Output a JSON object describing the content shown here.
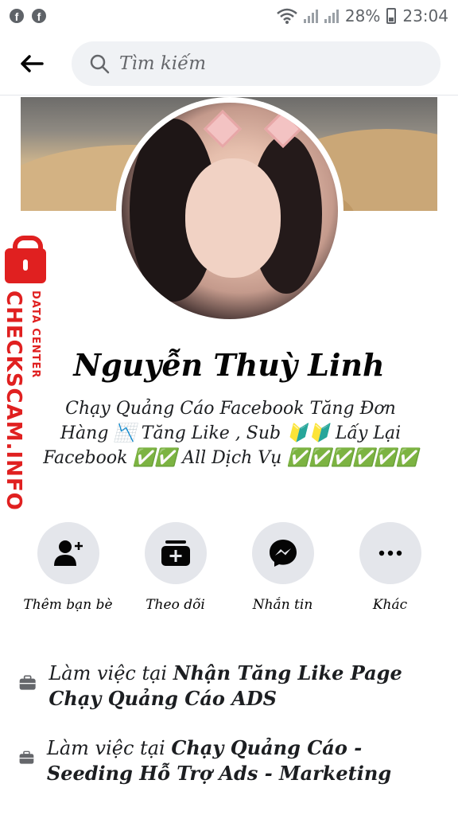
{
  "status_bar": {
    "battery": "28%",
    "time": "23:04"
  },
  "header": {
    "search_placeholder": "Tìm kiếm"
  },
  "watermark": {
    "main": "CHECKSCAM.INFO",
    "sub": "DATA CENTER"
  },
  "profile": {
    "name": "Nguyễn Thuỳ Linh",
    "bio": "Chạy Quảng Cáo Facebook Tăng Đơn Hàng 📉 Tăng Like , Sub 🔰🔰 Lấy Lại Facebook ✅✅ All Dịch Vụ ✅✅✅✅✅✅"
  },
  "actions": [
    {
      "label": "Thêm bạn bè",
      "icon": "add-friend-icon"
    },
    {
      "label": "Theo dõi",
      "icon": "follow-icon"
    },
    {
      "label": "Nhắn tin",
      "icon": "messenger-icon"
    },
    {
      "label": "Khác",
      "icon": "more-icon"
    }
  ],
  "work": [
    {
      "prefix": "Làm việc tại ",
      "place": "Nhận Tăng Like Page Chạy Quảng Cáo ADS"
    },
    {
      "prefix": "Làm việc tại ",
      "place": "Chạy Quảng Cáo - Seeding Hỗ Trợ Ads - Marketing"
    }
  ],
  "colors": {
    "accent_red": "#e02020",
    "chip_bg": "#e4e6eb",
    "search_bg": "#f0f2f5"
  }
}
